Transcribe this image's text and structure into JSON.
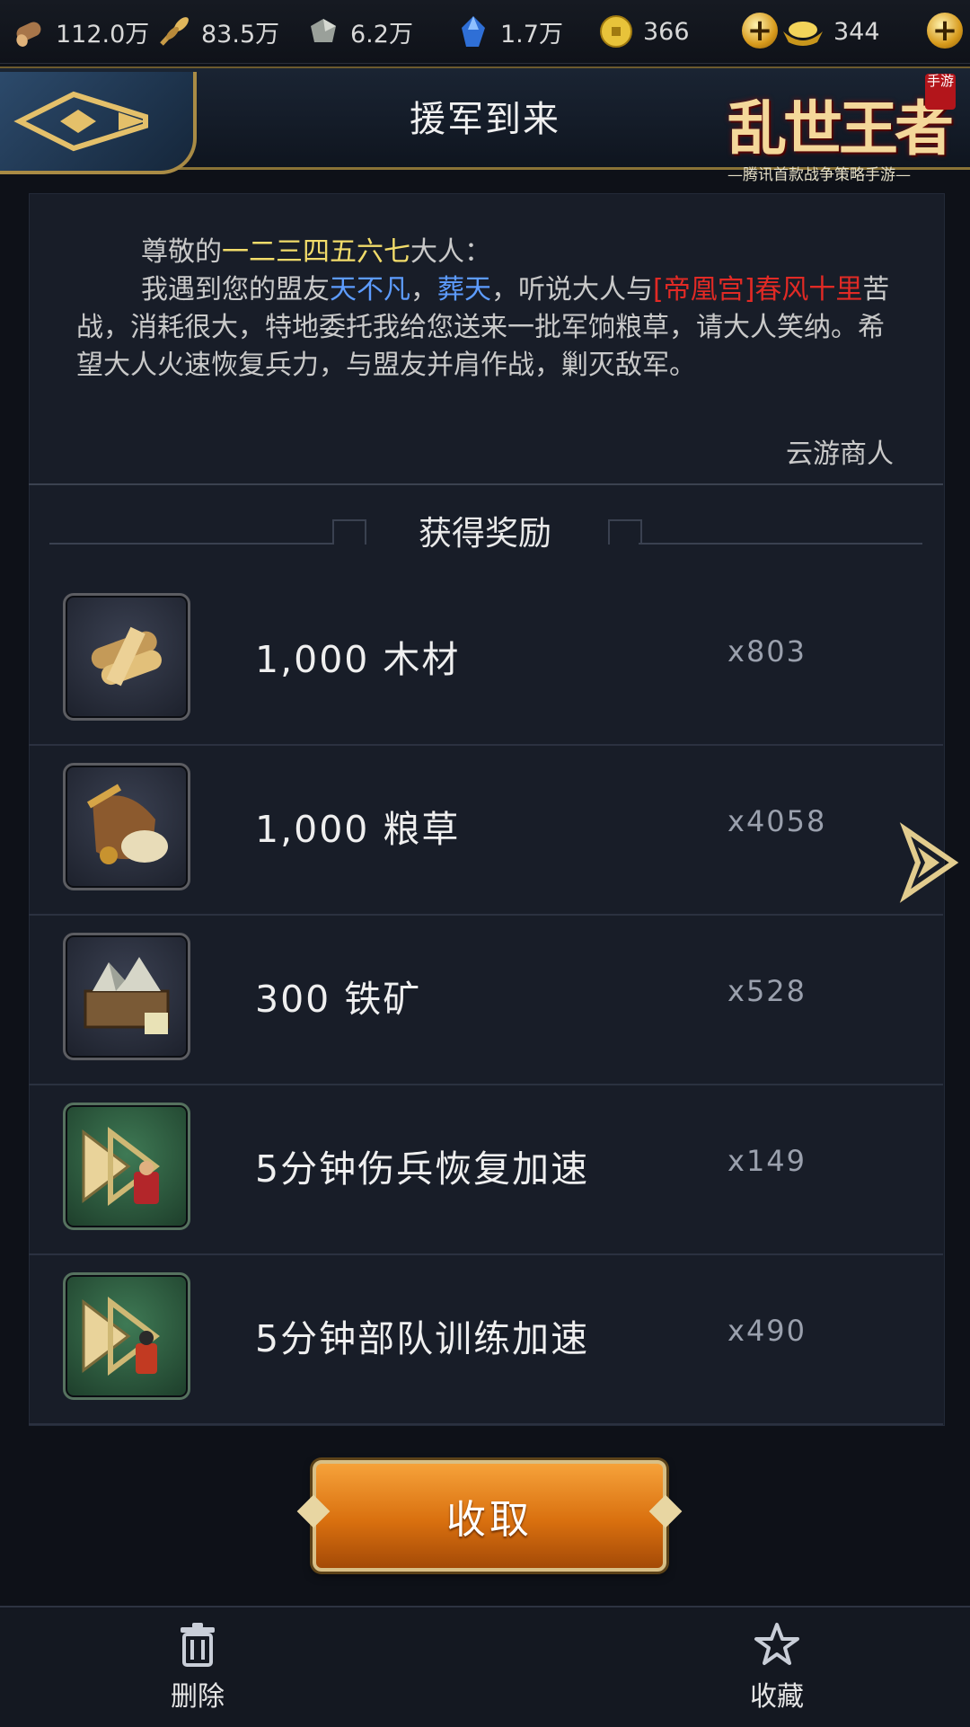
{
  "resources": [
    {
      "icon": "wood-icon",
      "value": "112.0万"
    },
    {
      "icon": "grain-icon",
      "value": "83.5万"
    },
    {
      "icon": "iron-icon",
      "value": "6.2万"
    },
    {
      "icon": "crystal-icon",
      "value": "1.7万"
    },
    {
      "icon": "coin-icon",
      "value": "366"
    },
    {
      "icon": "gold-ingot-icon",
      "value": "344"
    }
  ],
  "header": {
    "title": "援军到来",
    "logo_text": "乱世王者",
    "logo_tag": "手游",
    "logo_subtitle": "—腾讯首款战争策略手游—"
  },
  "letter": {
    "greeting_prefix": "尊敬的",
    "player_name": "一二三四五六七",
    "greeting_suffix": "大人：",
    "body_1": "我遇到您的盟友",
    "ally_1": "天不凡",
    "sep": "，",
    "ally_2": "葬天",
    "body_2": "，听说大人与",
    "enemy": "[帝凰宫]春风十里",
    "body_3": "苦战，消耗很大，特地委托我给您送来一批军饷粮草，请大人笑纳。希望大人火速恢复兵力，与盟友并肩作战，剿灭敌军。",
    "signature": "云游商人"
  },
  "rewards_title": "获得奖励",
  "rewards": [
    {
      "name": "1,000  木材",
      "count": "x803",
      "icon": "wood-bundle-icon",
      "frame": "dark"
    },
    {
      "name": "1,000  粮草",
      "count": "x4058",
      "icon": "grain-sack-icon",
      "frame": "dark"
    },
    {
      "name": "300  铁矿",
      "count": "x528",
      "icon": "iron-crate-icon",
      "frame": "dark"
    },
    {
      "name": "5分钟伤兵恢复加速",
      "count": "x149",
      "icon": "heal-speedup-icon",
      "frame": "green"
    },
    {
      "name": "5分钟部队训练加速",
      "count": "x490",
      "icon": "train-speedup-icon",
      "frame": "green"
    }
  ],
  "collect_label": "收取",
  "bottom": {
    "delete_label": "删除",
    "favorite_label": "收藏"
  },
  "colors": {
    "player_name": "#f2dc6a",
    "ally": "#5d9cff",
    "enemy": "#e12a25",
    "collect_button": "#e07a16",
    "green_frame": "#2f6a47"
  }
}
